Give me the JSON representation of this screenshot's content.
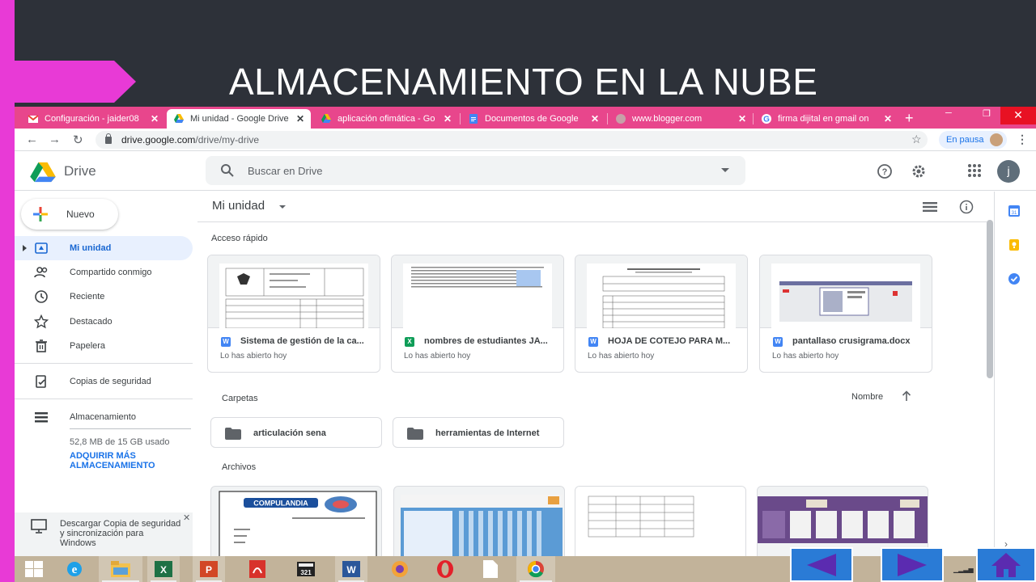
{
  "slide": {
    "title": "ALMACENAMIENTO EN LA NUBE",
    "accent_color": "#e83ad6",
    "background_color": "#2d3139"
  },
  "browser": {
    "tabs": [
      {
        "label": "Configuración - jaider08",
        "icon": "gmail-icon",
        "active": false
      },
      {
        "label": "Mi unidad - Google Drive",
        "icon": "drive-icon",
        "active": true
      },
      {
        "label": "aplicación ofimática - Go",
        "icon": "drive-icon",
        "active": false
      },
      {
        "label": "Documentos de Google",
        "icon": "docs-icon",
        "active": false
      },
      {
        "label": "www.blogger.com",
        "icon": "globe-icon",
        "active": false
      },
      {
        "label": "firma dijital en gmail on",
        "icon": "google-icon",
        "active": false
      }
    ],
    "new_tab_symbol": "+",
    "url_domain": "drive.google.com",
    "url_path": "/drive/my-drive",
    "profile_status": "En pausa"
  },
  "drive": {
    "app_name": "Drive",
    "search_placeholder": "Buscar en Drive",
    "avatar_initial": "j",
    "new_button_label": "Nuevo",
    "nav": [
      {
        "label": "Mi unidad",
        "icon": "my-drive-icon",
        "active": true
      },
      {
        "label": "Compartido conmigo",
        "icon": "shared-icon",
        "active": false
      },
      {
        "label": "Reciente",
        "icon": "clock-icon",
        "active": false
      },
      {
        "label": "Destacado",
        "icon": "star-icon",
        "active": false
      },
      {
        "label": "Papelera",
        "icon": "trash-icon",
        "active": false
      }
    ],
    "backups_label": "Copias de seguridad",
    "storage_label": "Almacenamiento",
    "storage_used": "52,8 MB de 15 GB usado",
    "storage_upgrade": "ADQUIRIR MÁS ALMACENAMIENTO",
    "backup_promo": "Descargar Copia de seguridad y sincronización para Windows",
    "main_title": "Mi unidad",
    "quick_access_label": "Acceso rápido",
    "quick_access": [
      {
        "name": "Sistema de gestión de la ca...",
        "subtitle": "Lo has abierto hoy",
        "type": "W",
        "type_color": "#4285f4"
      },
      {
        "name": "nombres de estudiantes JA...",
        "subtitle": "Lo has abierto hoy",
        "type": "X",
        "type_color": "#0f9d58"
      },
      {
        "name": "HOJA DE COTEJO PARA M...",
        "subtitle": "Lo has abierto hoy",
        "type": "W",
        "type_color": "#4285f4"
      },
      {
        "name": "pantallaso crusigrama.docx",
        "subtitle": "Lo has abierto hoy",
        "type": "W",
        "type_color": "#4285f4"
      }
    ],
    "folders_label": "Carpetas",
    "sort_label": "Nombre",
    "folders": [
      "articulación sena",
      "herramientas de Internet"
    ],
    "files_label": "Archivos",
    "file_thumb_text": "COMPULANDIA"
  }
}
